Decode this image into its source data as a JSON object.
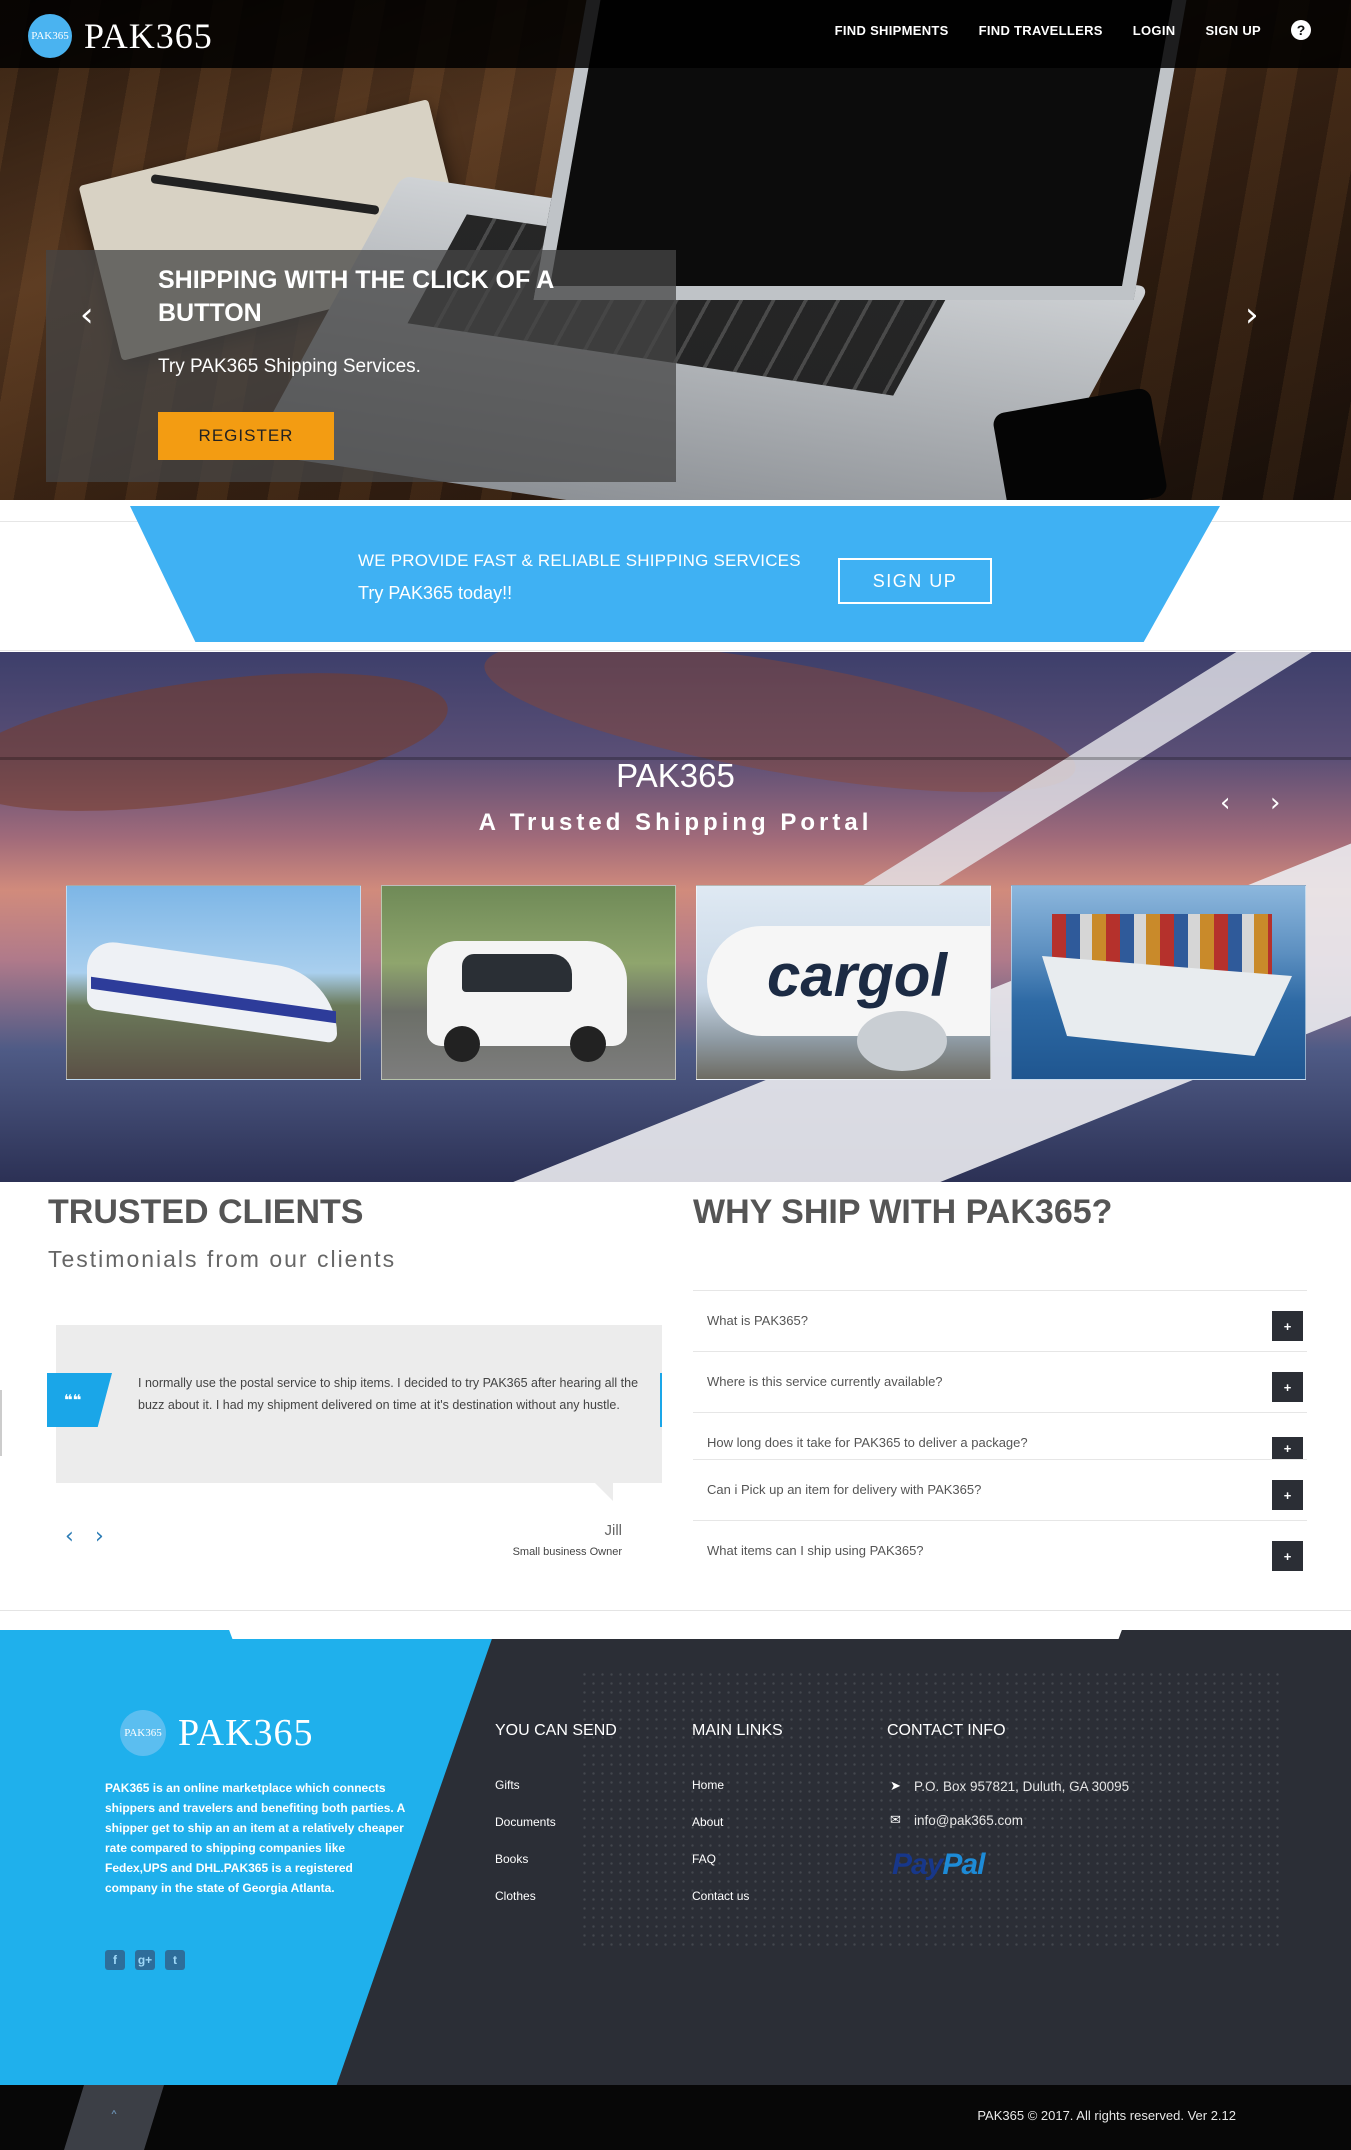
{
  "header": {
    "logo_mark": "PAK365",
    "logo_text": "PAK365",
    "nav": [
      "FIND SHIPMENTS",
      "FIND TRAVELLERS",
      "LOGIN",
      "SIGN UP"
    ],
    "help_icon": "?"
  },
  "hero": {
    "title": "SHIPPING WITH THE CLICK OF A BUTTON",
    "subtitle": "Try PAK365 Shipping Services.",
    "button": "REGISTER",
    "prev": "‹",
    "next": "›",
    "button_color": "#f39c12"
  },
  "banner": {
    "line1": "WE PROVIDE FAST & RELIABLE SHIPPING SERVICES",
    "line2": "Try PAK365 today!!",
    "button": "SIGN UP",
    "color": "#3fb1f3"
  },
  "portal": {
    "title": "PAK365",
    "subtitle": "A Trusted Shipping Portal",
    "prev": "‹",
    "next": "›",
    "tiles": [
      "train",
      "van",
      "cargo-plane",
      "container-ship"
    ],
    "plane_text": "cargol"
  },
  "clients": {
    "title": "TRUSTED CLIENTS",
    "subtitle": "Testimonials from our clients",
    "quote_icon": "❝❝",
    "quote": "I normally use the postal service to ship items. I decided to try PAK365 after hearing all the buzz about it. I had my shipment delivered on time at it's destination without any hustle.",
    "name": "Jill",
    "role": "Small business Owner",
    "prev": "‹",
    "next": "›"
  },
  "faq": {
    "title": "WHY SHIP WITH PAK365?",
    "items": [
      "What is PAK365?",
      "Where is this service currently available?",
      "How long does it take for PAK365 to deliver a package?",
      "Can i Pick up an item for delivery with PAK365?",
      "What items can I ship using PAK365?"
    ],
    "toggle": "+"
  },
  "footer": {
    "logo_mark": "PAK365",
    "logo_text": "PAK365",
    "about": "PAK365 is an online marketplace which connects shippers and travelers and benefiting both parties. A shipper get to ship an an item at a relatively cheaper rate compared to shipping companies like Fedex,UPS and DHL.PAK365 is a registered company in the state of Georgia Atlanta.",
    "social": [
      "f",
      "g+",
      "t"
    ],
    "send_title": "YOU CAN SEND",
    "send_items": [
      "Gifts",
      "Documents",
      "Books",
      "Clothes"
    ],
    "links_title": "MAIN LINKS",
    "links": [
      "Home",
      "About",
      "FAQ",
      "Contact us"
    ],
    "contact_title": "CONTACT INFO",
    "address": "P.O. Box 957821, Duluth, GA 30095",
    "email": "info@pak365.com",
    "paypal_pay": "Pay",
    "paypal_pal": "Pal",
    "copyright": "PAK365 © 2017. All rights reserved. Ver 2.12",
    "to_top": "˄",
    "accent": "#1fb0ec"
  }
}
